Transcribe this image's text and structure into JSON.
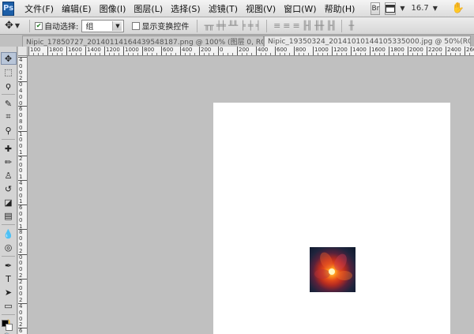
{
  "menubar": {
    "logo": "Ps",
    "items": [
      "文件(F)",
      "编辑(E)",
      "图像(I)",
      "图层(L)",
      "选择(S)",
      "滤镜(T)",
      "视图(V)",
      "窗口(W)",
      "帮助(H)"
    ],
    "bridge_button": "Br",
    "zoom": "16.7"
  },
  "options": {
    "auto_select_label": "自动选择:",
    "auto_select_value": "组",
    "show_transform_label": "显示变换控件"
  },
  "tabs": [
    {
      "title": "Nipic_17850727_20140114164439548187.png @ 100% (图层 0, RGB/8...",
      "close": "×"
    },
    {
      "title": "Nipic_19350324_20141010144105335000.jpg @ 50%(RGB/8#)",
      "close": ""
    }
  ],
  "ruler": {
    "h_labels": [
      "100",
      "1800",
      "1600",
      "1400",
      "1200",
      "1000",
      "800",
      "600",
      "400",
      "200",
      "0",
      "200",
      "400",
      "600",
      "800",
      "1000",
      "1200",
      "1400",
      "1600",
      "1800",
      "2000",
      "2200",
      "2400",
      "2600"
    ],
    "v_labels": [
      "4",
      "0",
      "0",
      "2",
      "0",
      "4",
      "0",
      "0",
      "6",
      "0",
      "8",
      "0",
      "1",
      "0",
      "0",
      "1",
      "2",
      "0",
      "0",
      "1",
      "4",
      "0",
      "0",
      "1",
      "6",
      "0",
      "0",
      "1",
      "8",
      "0",
      "0",
      "2",
      "0",
      "0",
      "0",
      "2",
      "2",
      "0",
      "0",
      "2",
      "4",
      "0",
      "0",
      "2",
      "6"
    ]
  },
  "tools": [
    {
      "name": "move-tool",
      "glyph": "✥"
    },
    {
      "name": "marquee-tool",
      "glyph": "⬚"
    },
    {
      "name": "lasso-tool",
      "glyph": "ϙ"
    },
    {
      "name": "quick-select-tool",
      "glyph": "✎"
    },
    {
      "name": "crop-tool",
      "glyph": "⌗"
    },
    {
      "name": "eyedropper-tool",
      "glyph": "⚲"
    },
    {
      "name": "healing-brush-tool",
      "glyph": "✚"
    },
    {
      "name": "brush-tool",
      "glyph": "✏"
    },
    {
      "name": "clone-stamp-tool",
      "glyph": "♙"
    },
    {
      "name": "history-brush-tool",
      "glyph": "↺"
    },
    {
      "name": "eraser-tool",
      "glyph": "◪"
    },
    {
      "name": "gradient-tool",
      "glyph": "▤"
    },
    {
      "name": "blur-tool",
      "glyph": "💧"
    },
    {
      "name": "dodge-tool",
      "glyph": "◎"
    },
    {
      "name": "pen-tool",
      "glyph": "✒"
    },
    {
      "name": "type-tool",
      "glyph": "T"
    },
    {
      "name": "path-select-tool",
      "glyph": "➤"
    },
    {
      "name": "shape-tool",
      "glyph": "▭"
    },
    {
      "name": "hand-tool",
      "glyph": "✋"
    },
    {
      "name": "zoom-tool",
      "glyph": "🔍"
    }
  ]
}
